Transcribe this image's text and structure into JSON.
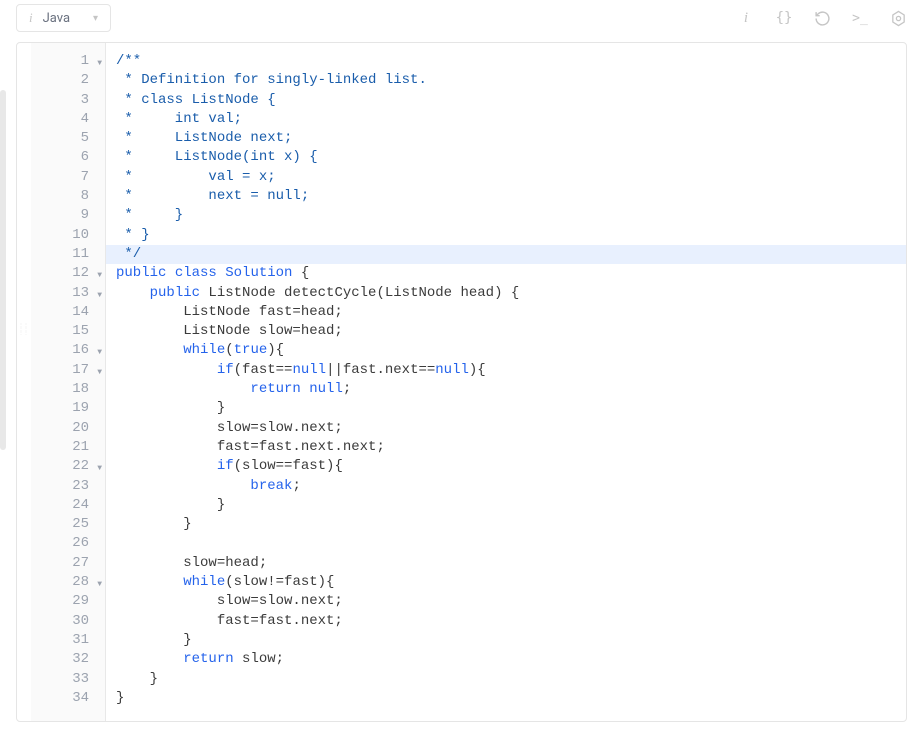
{
  "toolbar": {
    "language": "Java"
  },
  "gutter": {
    "lines": [
      {
        "num": "1",
        "fold": true
      },
      {
        "num": "2",
        "fold": false
      },
      {
        "num": "3",
        "fold": false
      },
      {
        "num": "4",
        "fold": false
      },
      {
        "num": "5",
        "fold": false
      },
      {
        "num": "6",
        "fold": false
      },
      {
        "num": "7",
        "fold": false
      },
      {
        "num": "8",
        "fold": false
      },
      {
        "num": "9",
        "fold": false
      },
      {
        "num": "10",
        "fold": false
      },
      {
        "num": "11",
        "fold": false
      },
      {
        "num": "12",
        "fold": true
      },
      {
        "num": "13",
        "fold": true
      },
      {
        "num": "14",
        "fold": false
      },
      {
        "num": "15",
        "fold": false
      },
      {
        "num": "16",
        "fold": true
      },
      {
        "num": "17",
        "fold": true
      },
      {
        "num": "18",
        "fold": false
      },
      {
        "num": "19",
        "fold": false
      },
      {
        "num": "20",
        "fold": false
      },
      {
        "num": "21",
        "fold": false
      },
      {
        "num": "22",
        "fold": true
      },
      {
        "num": "23",
        "fold": false
      },
      {
        "num": "24",
        "fold": false
      },
      {
        "num": "25",
        "fold": false
      },
      {
        "num": "26",
        "fold": false
      },
      {
        "num": "27",
        "fold": false
      },
      {
        "num": "28",
        "fold": true
      },
      {
        "num": "29",
        "fold": false
      },
      {
        "num": "30",
        "fold": false
      },
      {
        "num": "31",
        "fold": false
      },
      {
        "num": "32",
        "fold": false
      },
      {
        "num": "33",
        "fold": false
      },
      {
        "num": "34",
        "fold": false
      }
    ]
  },
  "code": {
    "highlighted_line": 11,
    "lines": [
      {
        "tokens": [
          {
            "cls": "c-comment",
            "t": "/**"
          }
        ]
      },
      {
        "tokens": [
          {
            "cls": "c-comment",
            "t": " * Definition for singly-linked list."
          }
        ]
      },
      {
        "tokens": [
          {
            "cls": "c-comment",
            "t": " * class ListNode {"
          }
        ]
      },
      {
        "tokens": [
          {
            "cls": "c-comment",
            "t": " *     int val;"
          }
        ]
      },
      {
        "tokens": [
          {
            "cls": "c-comment",
            "t": " *     ListNode next;"
          }
        ]
      },
      {
        "tokens": [
          {
            "cls": "c-comment",
            "t": " *     ListNode(int x) {"
          }
        ]
      },
      {
        "tokens": [
          {
            "cls": "c-comment",
            "t": " *         val = x;"
          }
        ]
      },
      {
        "tokens": [
          {
            "cls": "c-comment",
            "t": " *         next = null;"
          }
        ]
      },
      {
        "tokens": [
          {
            "cls": "c-comment",
            "t": " *     }"
          }
        ]
      },
      {
        "tokens": [
          {
            "cls": "c-comment",
            "t": " * }"
          }
        ]
      },
      {
        "tokens": [
          {
            "cls": "c-comment",
            "t": " */"
          }
        ]
      },
      {
        "tokens": [
          {
            "cls": "c-keyword",
            "t": "public"
          },
          {
            "cls": "c-plain",
            "t": " "
          },
          {
            "cls": "c-keyword",
            "t": "class"
          },
          {
            "cls": "c-plain",
            "t": " "
          },
          {
            "cls": "c-keyword",
            "t": "Solution"
          },
          {
            "cls": "c-plain",
            "t": " {"
          }
        ]
      },
      {
        "tokens": [
          {
            "cls": "c-plain",
            "t": "    "
          },
          {
            "cls": "c-keyword",
            "t": "public"
          },
          {
            "cls": "c-plain",
            "t": " ListNode "
          },
          {
            "cls": "c-method",
            "t": "detectCycle"
          },
          {
            "cls": "c-plain",
            "t": "(ListNode head) {"
          }
        ]
      },
      {
        "tokens": [
          {
            "cls": "c-plain",
            "t": "        ListNode fast=head;"
          }
        ]
      },
      {
        "tokens": [
          {
            "cls": "c-plain",
            "t": "        ListNode slow=head;"
          }
        ]
      },
      {
        "tokens": [
          {
            "cls": "c-plain",
            "t": "        "
          },
          {
            "cls": "c-keyword",
            "t": "while"
          },
          {
            "cls": "c-plain",
            "t": "("
          },
          {
            "cls": "c-literal",
            "t": "true"
          },
          {
            "cls": "c-plain",
            "t": "){"
          }
        ]
      },
      {
        "tokens": [
          {
            "cls": "c-plain",
            "t": "            "
          },
          {
            "cls": "c-keyword",
            "t": "if"
          },
          {
            "cls": "c-plain",
            "t": "(fast=="
          },
          {
            "cls": "c-null",
            "t": "null"
          },
          {
            "cls": "c-plain",
            "t": "||fast.next=="
          },
          {
            "cls": "c-null",
            "t": "null"
          },
          {
            "cls": "c-plain",
            "t": "){"
          }
        ]
      },
      {
        "tokens": [
          {
            "cls": "c-plain",
            "t": "                "
          },
          {
            "cls": "c-keyword",
            "t": "return"
          },
          {
            "cls": "c-plain",
            "t": " "
          },
          {
            "cls": "c-null",
            "t": "null"
          },
          {
            "cls": "c-plain",
            "t": ";"
          }
        ]
      },
      {
        "tokens": [
          {
            "cls": "c-plain",
            "t": "            }"
          }
        ]
      },
      {
        "tokens": [
          {
            "cls": "c-plain",
            "t": "            slow=slow.next;"
          }
        ]
      },
      {
        "tokens": [
          {
            "cls": "c-plain",
            "t": "            fast=fast.next.next;"
          }
        ]
      },
      {
        "tokens": [
          {
            "cls": "c-plain",
            "t": "            "
          },
          {
            "cls": "c-keyword",
            "t": "if"
          },
          {
            "cls": "c-plain",
            "t": "(slow==fast){"
          }
        ]
      },
      {
        "tokens": [
          {
            "cls": "c-plain",
            "t": "                "
          },
          {
            "cls": "c-keyword",
            "t": "break"
          },
          {
            "cls": "c-plain",
            "t": ";"
          }
        ]
      },
      {
        "tokens": [
          {
            "cls": "c-plain",
            "t": "            }"
          }
        ]
      },
      {
        "tokens": [
          {
            "cls": "c-plain",
            "t": "        }"
          }
        ]
      },
      {
        "tokens": [
          {
            "cls": "c-plain",
            "t": ""
          }
        ]
      },
      {
        "tokens": [
          {
            "cls": "c-plain",
            "t": "        slow=head;"
          }
        ]
      },
      {
        "tokens": [
          {
            "cls": "c-plain",
            "t": "        "
          },
          {
            "cls": "c-keyword",
            "t": "while"
          },
          {
            "cls": "c-plain",
            "t": "(slow!=fast){"
          }
        ]
      },
      {
        "tokens": [
          {
            "cls": "c-plain",
            "t": "            slow=slow.next;"
          }
        ]
      },
      {
        "tokens": [
          {
            "cls": "c-plain",
            "t": "            fast=fast.next;"
          }
        ]
      },
      {
        "tokens": [
          {
            "cls": "c-plain",
            "t": "        }"
          }
        ]
      },
      {
        "tokens": [
          {
            "cls": "c-plain",
            "t": "        "
          },
          {
            "cls": "c-keyword",
            "t": "return"
          },
          {
            "cls": "c-plain",
            "t": " slow;"
          }
        ]
      },
      {
        "tokens": [
          {
            "cls": "c-plain",
            "t": "    }"
          }
        ]
      },
      {
        "tokens": [
          {
            "cls": "c-plain",
            "t": "}"
          }
        ]
      }
    ]
  }
}
